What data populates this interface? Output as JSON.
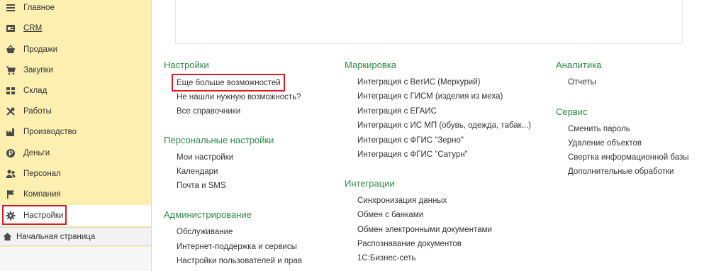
{
  "sidebar": {
    "items": [
      {
        "label": "Главное",
        "icon": "menu-lines-icon"
      },
      {
        "label": "CRM",
        "icon": "crm-card-icon"
      },
      {
        "label": "Продажи",
        "icon": "basket-icon"
      },
      {
        "label": "Закупки",
        "icon": "cart-icon"
      },
      {
        "label": "Склад",
        "icon": "warehouse-grid-icon"
      },
      {
        "label": "Работы",
        "icon": "tools-icon"
      },
      {
        "label": "Производство",
        "icon": "factory-icon"
      },
      {
        "label": "Деньги",
        "icon": "ruble-coin-icon"
      },
      {
        "label": "Персонал",
        "icon": "people-icon"
      },
      {
        "label": "Компания",
        "icon": "flag-icon"
      },
      {
        "label": "Настройки",
        "icon": "gear-icon"
      }
    ],
    "home_label": "Начальная страница",
    "highlight_color": "#d51d2c"
  },
  "columns": {
    "col1": {
      "sections": [
        {
          "title": "Настройки",
          "links": [
            "Еще больше возможностей",
            "Не нашли нужную возможность?",
            "Все справочники"
          ]
        },
        {
          "title": "Персональные настройки",
          "links": [
            "Мои настройки",
            "Календари",
            "Почта и SMS"
          ]
        },
        {
          "title": "Администрирование",
          "links": [
            "Обслуживание",
            "Интернет-поддержка и сервисы",
            "Настройки пользователей и прав"
          ]
        }
      ]
    },
    "col2": {
      "sections": [
        {
          "title": "Маркировка",
          "links": [
            "Интеграция с ВетИС (Меркурий)",
            "Интеграция с ГИСМ (изделия из меха)",
            "Интеграция с ЕГАИС",
            "Интеграция с ИС МП (обувь, одежда, табак...)",
            "Интеграция с ФГИС \"Зерно\"",
            "Интеграция с ФГИС \"Сатурн\""
          ]
        },
        {
          "title": "Интеграции",
          "links": [
            "Синхронизация данных",
            "Обмен с банками",
            "Обмен электронными документами",
            "Распознавание документов",
            "1С:Бизнес-сеть"
          ]
        }
      ]
    },
    "col3": {
      "sections": [
        {
          "title": "Аналитика",
          "links": [
            "Отчеты"
          ]
        },
        {
          "title": "Сервис",
          "links": [
            "Сменить пароль",
            "Удаление объектов",
            "Свертка информационной базы",
            "Дополнительные обработки"
          ]
        }
      ]
    }
  },
  "colors": {
    "section_title": "#2e8b46",
    "sidebar_bg": "#fcefb0",
    "highlight": "#d51d2c"
  }
}
